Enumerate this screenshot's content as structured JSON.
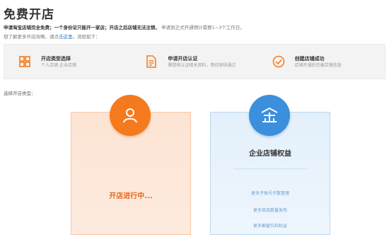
{
  "page": {
    "title": "免费开店",
    "notice_bold": "申请淘宝店铺完全免费；一个身份证只能开一家店；开店之后店铺无法注销，",
    "notice_rest": "申请到正式开通预计需要1~3个工作日。",
    "guide_prefix": "想了解更多开店攻略，请点",
    "guide_link": "击这里",
    "guide_suffix": "。流程如下："
  },
  "steps": [
    {
      "icon": "grid-icon",
      "title": "开店类型选择",
      "desc": "个人店铺  企业店铺"
    },
    {
      "icon": "document-icon",
      "title": "申请开店认证",
      "desc": "需提供认证相关资料，等待审核通过"
    },
    {
      "icon": "check-circle-icon",
      "title": "创建店铺成功",
      "desc": "店铺开通后完善店铺信息"
    }
  ],
  "choose_label": "选择开店类型：",
  "personal_card": {
    "icon": "person-icon",
    "status": "开店进行中..."
  },
  "enterprise_card": {
    "icon": "enterprise-icon",
    "title": "企业店铺权益",
    "benefits": [
      "更多子账号子数管理",
      "更多商品数量发布",
      "更多橱窗位和权益"
    ]
  },
  "colors": {
    "orange": "#f57a1e",
    "blue": "#3b8fdc",
    "link": "#3a78c3"
  }
}
